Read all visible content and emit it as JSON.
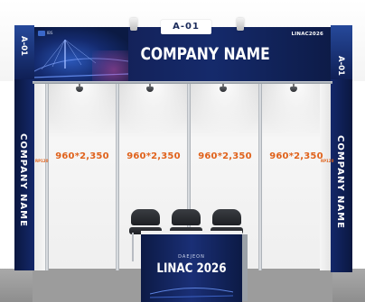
{
  "booth": {
    "number": "A-01",
    "company_name": "COMPANY NAME",
    "event_name": "LINAC 2026",
    "event_name_header": "LINAC2026",
    "event_host_prefix": "DAEJEON",
    "header_logo_text": "IBS",
    "side_code": "RP120"
  },
  "panels": {
    "dimension_labels": [
      "960*2,350",
      "960*2,350",
      "960*2,350",
      "960*2,350"
    ]
  },
  "colors": {
    "brand_navy": "#0c1a45",
    "dimension_orange": "#e0621b"
  }
}
